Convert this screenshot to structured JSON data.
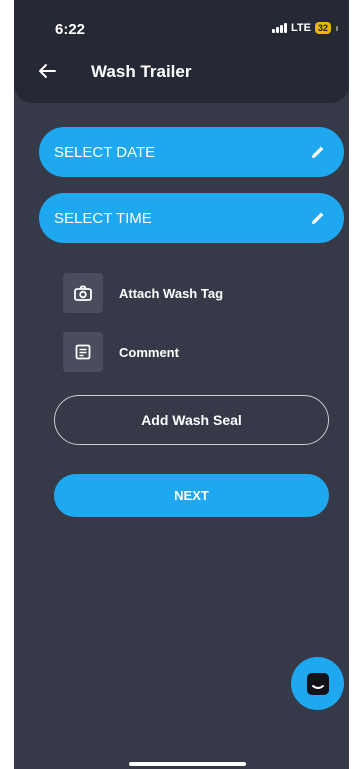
{
  "status_bar": {
    "time": "6:22",
    "network": "LTE",
    "battery": "32"
  },
  "header": {
    "title": "Wash Trailer",
    "back_icon": "arrow-left-icon"
  },
  "fields": {
    "date": {
      "label": "SELECT DATE",
      "icon": "pencil-icon"
    },
    "time": {
      "label": "SELECT TIME",
      "icon": "pencil-icon"
    }
  },
  "actions": {
    "attach": {
      "label": "Attach Wash Tag",
      "icon": "camera-icon"
    },
    "comment": {
      "label": "Comment",
      "icon": "note-icon"
    }
  },
  "buttons": {
    "add_seal": "Add Wash Seal",
    "next": "NEXT"
  },
  "chat": {
    "icon": "chat-icon"
  },
  "colors": {
    "background": "#363947",
    "header": "#262833",
    "accent": "#1ea8f0",
    "icon_tile": "#4a4d5e"
  }
}
